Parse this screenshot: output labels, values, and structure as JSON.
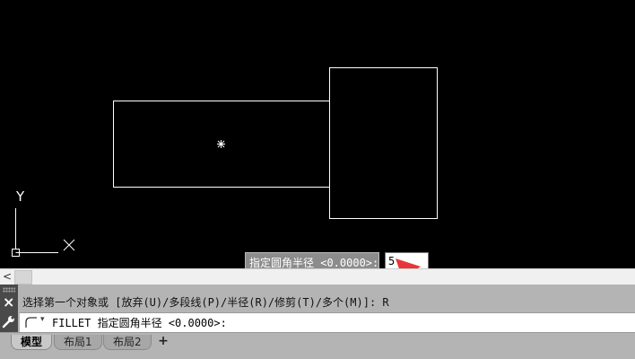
{
  "canvas": {
    "ucs": {
      "y_label": "Y",
      "x_label": "X"
    }
  },
  "dynamic_input": {
    "prompt": "指定圆角半径 <0.0000>:",
    "value": "5"
  },
  "scrollbar": {
    "left_arrow": "<"
  },
  "command": {
    "close_icon": "×",
    "history": "选择第一个对象或 [放弃(U)/多段线(P)/半径(R)/修剪(T)/多个(M)]: R",
    "current": "FILLET 指定圆角半径 <0.0000>:"
  },
  "tabs": {
    "items": [
      {
        "label": "模型",
        "active": true
      },
      {
        "label": "布局1",
        "active": false
      },
      {
        "label": "布局2",
        "active": false
      }
    ],
    "add_label": "+"
  },
  "colors": {
    "background": "#000000",
    "lines": "#ffffff",
    "arrow": "#e8353a",
    "command_bg": "#b4b4b4",
    "prompt_bg": "#8c8c8c"
  },
  "icons": [
    "close-icon",
    "wrench-icon",
    "fillet-icon",
    "crosshair-icon",
    "ucs-icon",
    "arrow-annotation"
  ]
}
